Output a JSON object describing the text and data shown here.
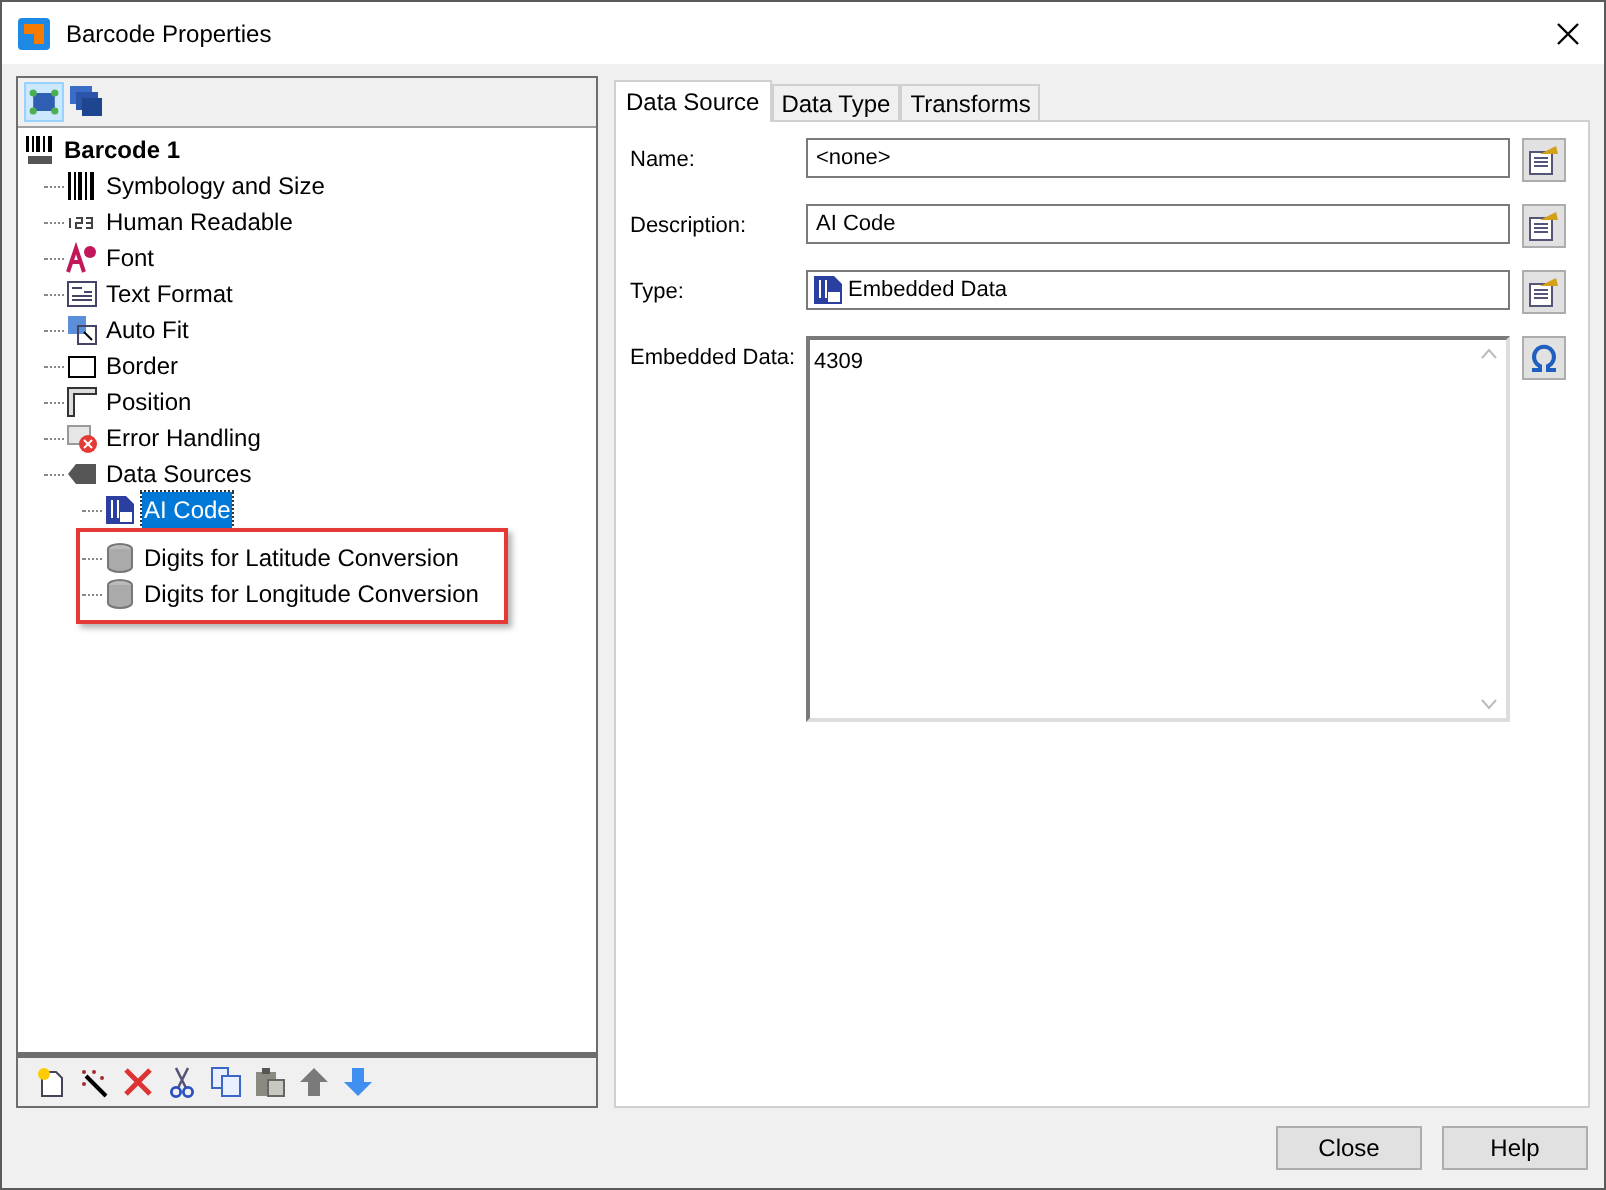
{
  "window": {
    "title": "Barcode Properties"
  },
  "tree": {
    "label": "Barcode 1",
    "kind": "barcode",
    "selected": false,
    "children": [
      {
        "label": "Symbology and Size",
        "kind": "bars",
        "selected": false
      },
      {
        "label": "Human Readable",
        "kind": "digits",
        "selected": false
      },
      {
        "label": "Font",
        "kind": "font",
        "selected": false
      },
      {
        "label": "Text Format",
        "kind": "textformat",
        "selected": false
      },
      {
        "label": "Auto Fit",
        "kind": "autofit",
        "selected": false
      },
      {
        "label": "Border",
        "kind": "border",
        "selected": false
      },
      {
        "label": "Position",
        "kind": "ruler",
        "selected": false
      },
      {
        "label": "Error Handling",
        "kind": "error",
        "selected": false
      },
      {
        "label": "Data Sources",
        "kind": "datasources",
        "selected": false,
        "children": [
          {
            "label": "AI Code",
            "kind": "embedded",
            "selected": true
          },
          {
            "label": "Digits for Latitude Conversion",
            "kind": "database",
            "selected": false,
            "highlighted": true
          },
          {
            "label": "Digits for Longitude Conversion",
            "kind": "database",
            "selected": false,
            "highlighted": true
          }
        ]
      }
    ]
  },
  "tabs": [
    {
      "label": "Data Source",
      "selected": true
    },
    {
      "label": "Data Type",
      "selected": false
    },
    {
      "label": "Transforms",
      "selected": false
    }
  ],
  "fields": [
    {
      "label": "Name:",
      "value": "<none>",
      "kind": "text"
    },
    {
      "label": "Description:",
      "value": "AI Code",
      "kind": "text"
    },
    {
      "label": "Type:",
      "value": "Embedded Data",
      "kind": "type"
    },
    {
      "label": "Embedded Data:",
      "value": "4309",
      "kind": "multiline"
    }
  ],
  "buttons": [
    "Close",
    "Help"
  ]
}
